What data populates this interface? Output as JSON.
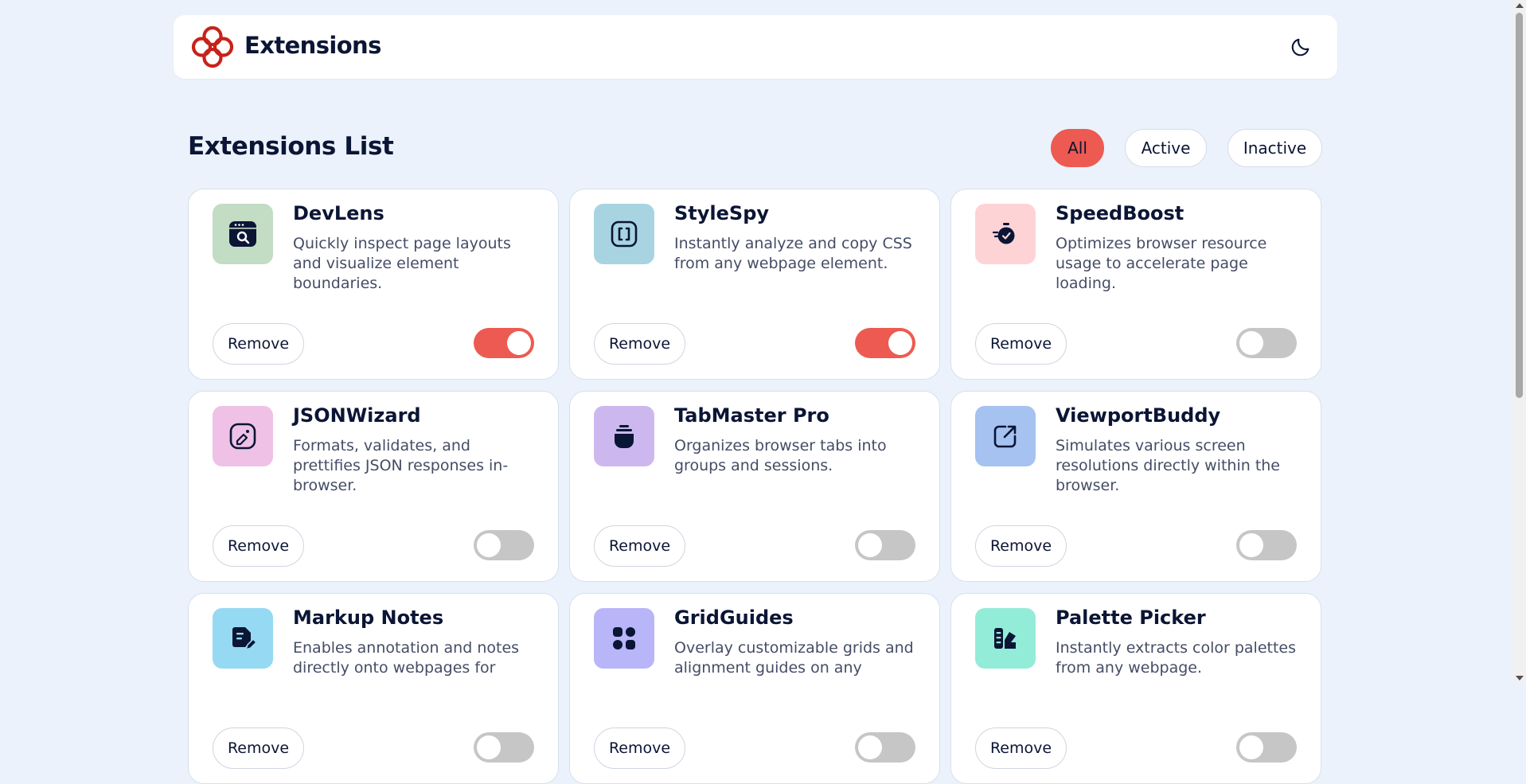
{
  "header": {
    "logo_text": "Extensions",
    "logo_icon": "logo-icon",
    "theme_icon": "moon-icon"
  },
  "list": {
    "title": "Extensions List",
    "filters": [
      {
        "label": "All",
        "selected": true
      },
      {
        "label": "Active",
        "selected": false
      },
      {
        "label": "Inactive",
        "selected": false
      }
    ]
  },
  "colors": {
    "accent": "#ed5a51",
    "background": "#ebf2fb",
    "text": "#0b1535"
  },
  "extensions": [
    {
      "name": "DevLens",
      "description": "Quickly inspect page layouts and visualize element boundaries.",
      "remove_label": "Remove",
      "active": true,
      "icon": "devlens-icon",
      "icon_bg": "#c3dcc4"
    },
    {
      "name": "StyleSpy",
      "description": "Instantly analyze and copy CSS from any webpage element.",
      "remove_label": "Remove",
      "active": true,
      "icon": "stylespy-icon",
      "icon_bg": "#a8d4e2"
    },
    {
      "name": "SpeedBoost",
      "description": "Optimizes browser resource usage to accelerate page loading.",
      "remove_label": "Remove",
      "active": false,
      "icon": "speedboost-icon",
      "icon_bg": "#fed3d6"
    },
    {
      "name": "JSONWizard",
      "description": "Formats, validates, and prettifies JSON responses in-browser.",
      "remove_label": "Remove",
      "active": false,
      "icon": "jsonwizard-icon",
      "icon_bg": "#efc1e6"
    },
    {
      "name": "TabMaster Pro",
      "description": "Organizes browser tabs into groups and sessions.",
      "remove_label": "Remove",
      "active": false,
      "icon": "tabmaster-icon",
      "icon_bg": "#ccb8ef"
    },
    {
      "name": "ViewportBuddy",
      "description": "Simulates various screen resolutions directly within the browser.",
      "remove_label": "Remove",
      "active": false,
      "icon": "viewportbuddy-icon",
      "icon_bg": "#a5c2f0"
    },
    {
      "name": "Markup Notes",
      "description": "Enables annotation and notes directly onto webpages for",
      "remove_label": "Remove",
      "active": false,
      "icon": "markupnotes-icon",
      "icon_bg": "#96d9f2"
    },
    {
      "name": "GridGuides",
      "description": "Overlay customizable grids and alignment guides on any",
      "remove_label": "Remove",
      "active": false,
      "icon": "gridguides-icon",
      "icon_bg": "#b8b5f8"
    },
    {
      "name": "Palette Picker",
      "description": "Instantly extracts color palettes from any webpage.",
      "remove_label": "Remove",
      "active": false,
      "icon": "palettepicker-icon",
      "icon_bg": "#93ecd8"
    }
  ]
}
